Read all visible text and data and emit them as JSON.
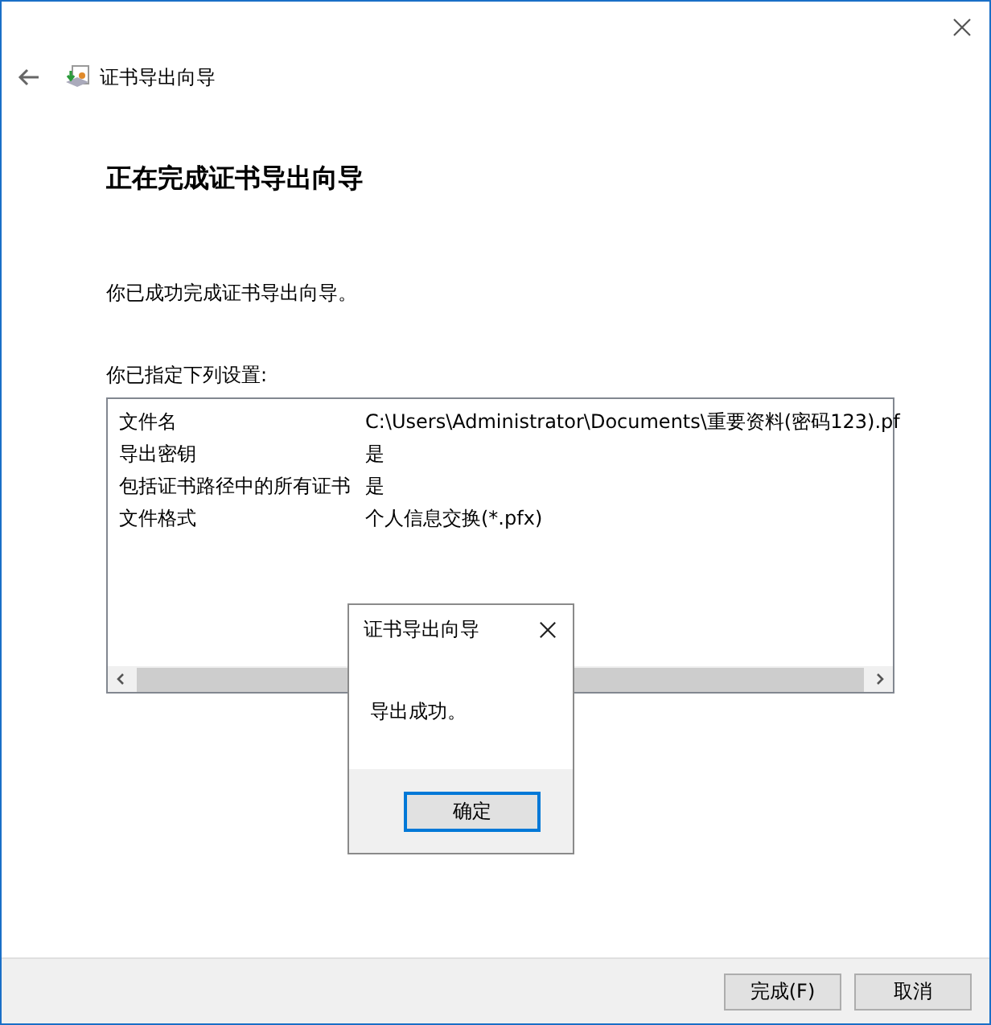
{
  "window": {
    "title": "证书导出向导"
  },
  "heading": "正在完成证书导出向导",
  "intro": "你已成功完成证书导出向导。",
  "settings_label": "你已指定下列设置:",
  "settings": [
    {
      "name": "文件名",
      "value": "C:\\Users\\Administrator\\Documents\\重要资料(密码123).pf"
    },
    {
      "name": "导出密钥",
      "value": "是"
    },
    {
      "name": "包括证书路径中的所有证书",
      "value": "是"
    },
    {
      "name": "文件格式",
      "value": "个人信息交换(*.pfx)"
    }
  ],
  "message_box": {
    "title": "证书导出向导",
    "message": "导出成功。",
    "button": "确定"
  },
  "buttons": [
    "完成(F)",
    "取消"
  ]
}
